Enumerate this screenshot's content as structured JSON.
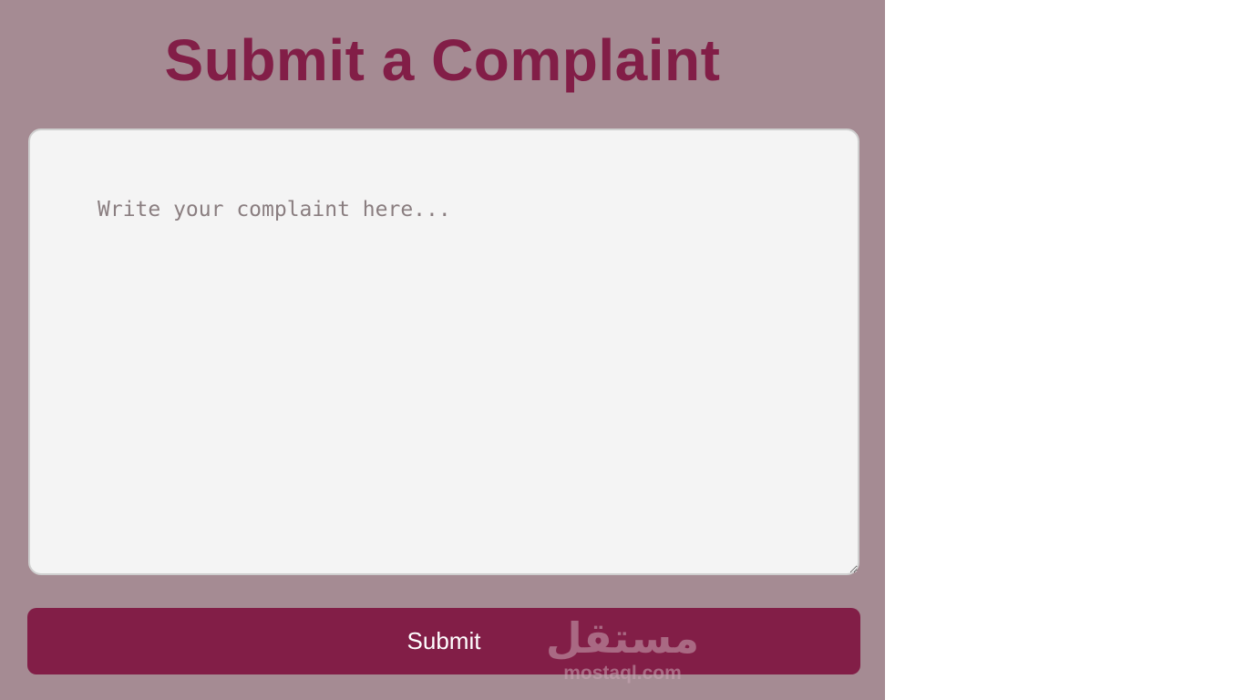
{
  "page": {
    "title": "Submit a Complaint"
  },
  "form": {
    "complaint_placeholder": "Write your complaint here...",
    "complaint_value": "",
    "submit_label": "Submit"
  },
  "watermark": {
    "logo_text": "مستقل",
    "domain": "mostaql.com"
  },
  "colors": {
    "panel_background": "#a58b93",
    "accent": "#821e47",
    "textarea_background": "#f4f4f4"
  }
}
